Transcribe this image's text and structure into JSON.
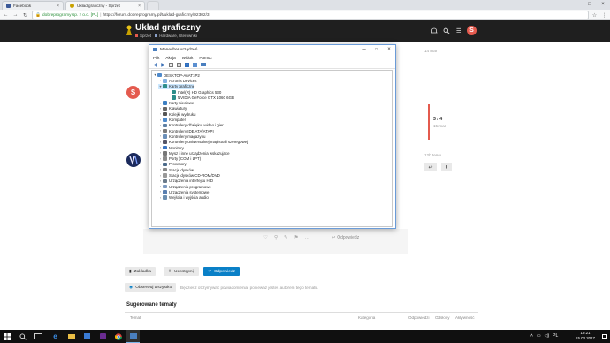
{
  "browser": {
    "tabs": [
      {
        "label": "Facebook",
        "icon": "facebook-icon",
        "color": "#3b5998"
      },
      {
        "label": "Układ graficzny - Sprzęt",
        "icon": "dobreprogramy-icon",
        "color": "#c8a100"
      }
    ],
    "security_label": "dobreprogramy sp. z o.o. [PL]",
    "url": "https://forum.dobreprogramy.pl/t/uklad-graficzny/92302/3"
  },
  "site": {
    "title": "Układ graficzny",
    "category": "Sprzęt",
    "subcategory": "Hardware, Sterowniki",
    "avatar_letter": "S",
    "accent": "#e45a4e"
  },
  "forum": {
    "post_date_1": "14 mar",
    "timeline_position": "3 / 4",
    "timeline_date": "15 mar",
    "post_date_2": "12h temu",
    "reply_label": "Odpowiedz",
    "avatar_letter": "S",
    "actions": {
      "bookmark": "Zakładka",
      "share": "Udostępnij",
      "reply": "Odpowiedz"
    },
    "watching_label": "Obserwuj wszystko",
    "watching_note": "Będziesz otrzymywać powiadomienia, ponieważ jesteś autorem tego tematu.",
    "suggested_title": "Sugerowane tematy",
    "columns": [
      "Temat",
      "Kategoria",
      "Odpowiedzi",
      "Odsłony",
      "Aktywność"
    ]
  },
  "device_manager": {
    "title": "Menedżer urządzeń",
    "menu": [
      "Plik",
      "Akcja",
      "Widok",
      "Pomoc"
    ],
    "root": "DESKTOP-A6AT1P2",
    "nodes": [
      {
        "label": "Acronis Devices",
        "icon": "device-icon",
        "expanded": false,
        "child": false
      },
      {
        "label": "Karty graficzne",
        "icon": "display-adapter-icon",
        "expanded": true,
        "child": false
      },
      {
        "label": "Intel(R) HD Graphics 530",
        "icon": "display-adapter-icon",
        "expanded": false,
        "child": true
      },
      {
        "label": "NVIDIA GeForce GTX 1060 6GB",
        "icon": "display-adapter-icon",
        "expanded": false,
        "child": true
      },
      {
        "label": "Karty sieciowe",
        "icon": "network-icon",
        "expanded": false,
        "child": false
      },
      {
        "label": "Klawiatury",
        "icon": "keyboard-icon",
        "expanded": false,
        "child": false
      },
      {
        "label": "Kolejki wydruku",
        "icon": "printer-icon",
        "expanded": false,
        "child": false
      },
      {
        "label": "Komputer",
        "icon": "computer-icon",
        "expanded": false,
        "child": false
      },
      {
        "label": "Kontrolery dźwięku, wideo i gier",
        "icon": "sound-icon",
        "expanded": false,
        "child": false
      },
      {
        "label": "Kontrolery IDE ATA/ATAPI",
        "icon": "ide-controller-icon",
        "expanded": false,
        "child": false
      },
      {
        "label": "Kontrolery magazynu",
        "icon": "storage-icon",
        "expanded": false,
        "child": false
      },
      {
        "label": "Kontrolery uniwersalnej magistrali szeregowej",
        "icon": "usb-icon",
        "expanded": false,
        "child": false
      },
      {
        "label": "Monitory",
        "icon": "monitor-icon",
        "expanded": false,
        "child": false
      },
      {
        "label": "Mysz i inne urządzenia wskazujące",
        "icon": "mouse-icon",
        "expanded": false,
        "child": false
      },
      {
        "label": "Porty (COM i LPT)",
        "icon": "port-icon",
        "expanded": false,
        "child": false
      },
      {
        "label": "Procesory",
        "icon": "cpu-icon",
        "expanded": false,
        "child": false
      },
      {
        "label": "Stacje dysków",
        "icon": "disk-icon",
        "expanded": false,
        "child": false
      },
      {
        "label": "Stacje dysków CD-ROM/DVD",
        "icon": "dvd-icon",
        "expanded": false,
        "child": false
      },
      {
        "label": "Urządzenia interfejsu HID",
        "icon": "hid-icon",
        "expanded": false,
        "child": false
      },
      {
        "label": "Urządzenia programowe",
        "icon": "software-device-icon",
        "expanded": false,
        "child": false
      },
      {
        "label": "Urządzenia systemowe",
        "icon": "system-device-icon",
        "expanded": false,
        "child": false
      },
      {
        "label": "Wejścia i wyjścia audio",
        "icon": "audio-io-icon",
        "expanded": false,
        "child": false
      }
    ]
  },
  "taskbar": {
    "time": "19:21",
    "date": "15.03.2017"
  }
}
